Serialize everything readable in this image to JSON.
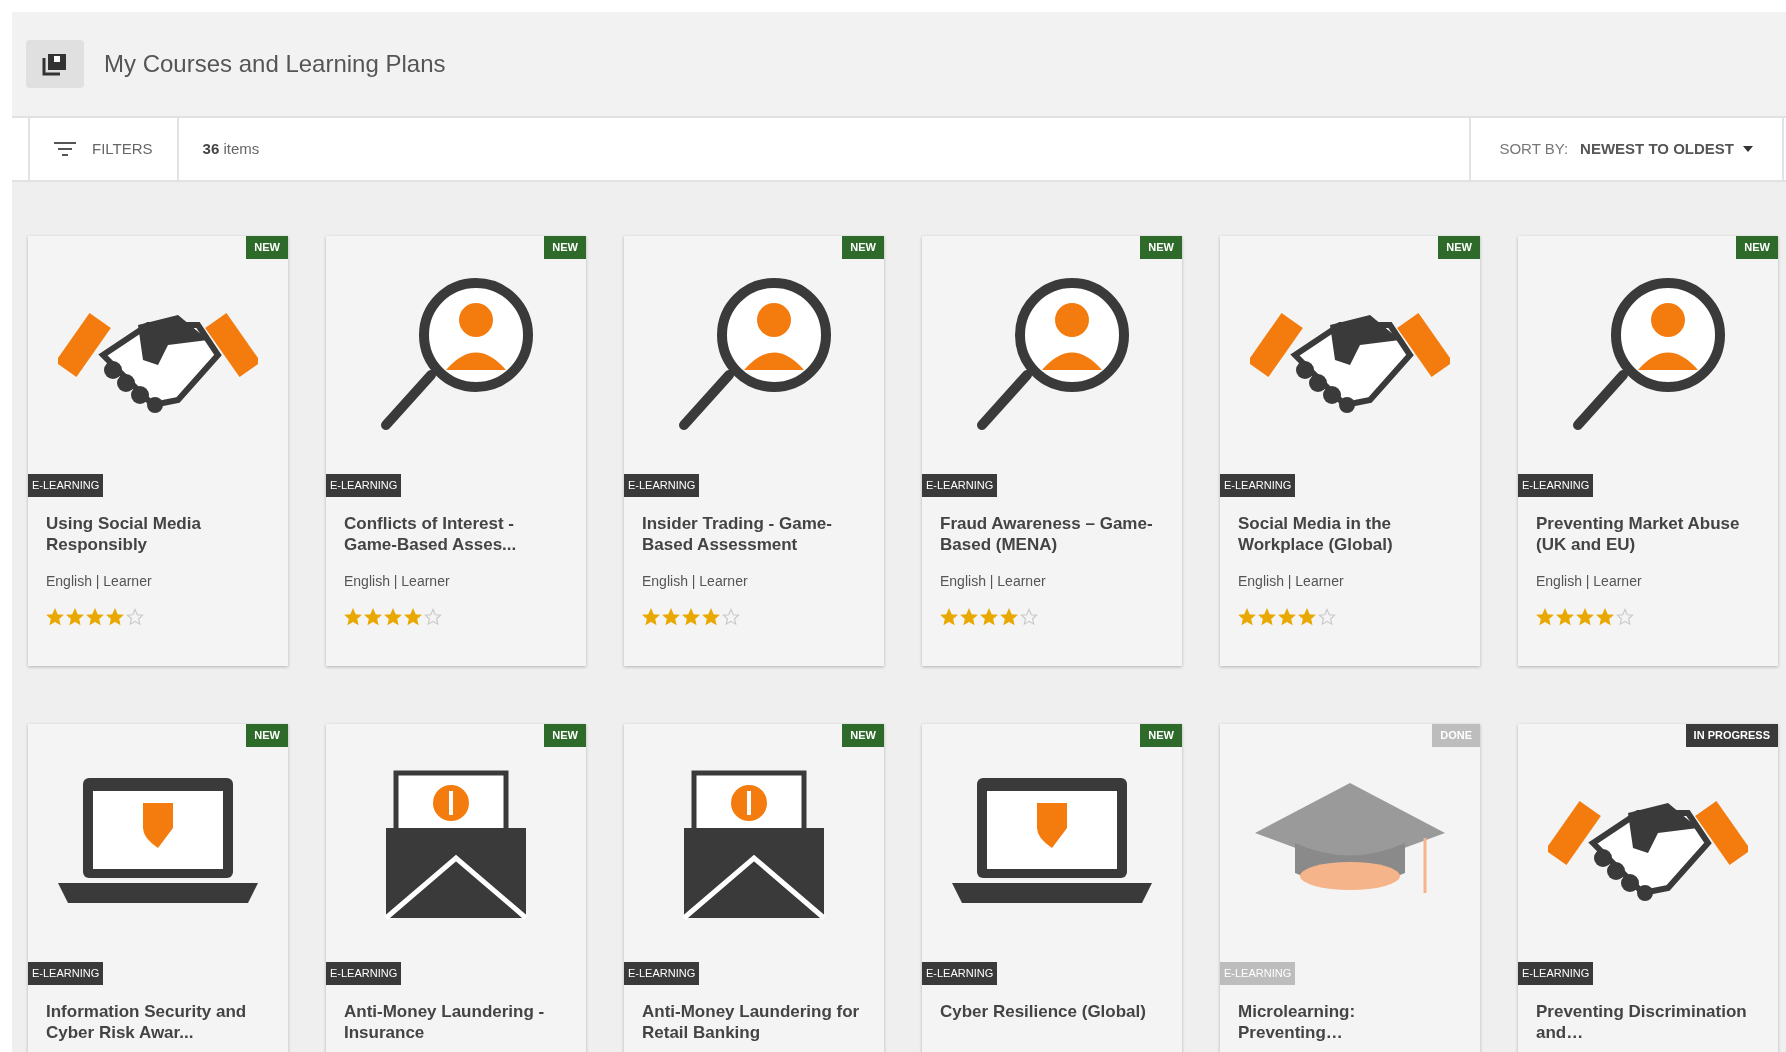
{
  "header": {
    "title": "My Courses and Learning Plans"
  },
  "toolbar": {
    "filters": "FILTERS",
    "count": "36",
    "count_label": "items",
    "sort_label": "SORT BY:",
    "sort_value": "NEWEST TO OLDEST"
  },
  "courses": [
    {
      "kind": "handshake",
      "status": {
        "label": "NEW",
        "color": "#2e6b2a"
      },
      "type": "E-LEARNING",
      "dimmed": false,
      "title": "Using Social Media Responsibly",
      "meta": "English | Learner",
      "stars": 4
    },
    {
      "kind": "magnifier",
      "status": {
        "label": "NEW",
        "color": "#2e6b2a"
      },
      "type": "E-LEARNING",
      "dimmed": false,
      "title": "Conflicts of Interest - Game-Based Asses...",
      "meta": "English | Learner",
      "stars": 4
    },
    {
      "kind": "magnifier",
      "status": {
        "label": "NEW",
        "color": "#2e6b2a"
      },
      "type": "E-LEARNING",
      "dimmed": false,
      "title": "Insider Trading - Game-Based Assessment",
      "meta": "English | Learner",
      "stars": 4
    },
    {
      "kind": "magnifier",
      "status": {
        "label": "NEW",
        "color": "#2e6b2a"
      },
      "type": "E-LEARNING",
      "dimmed": false,
      "title": "Fraud Awareness – Game-Based (MENA)",
      "meta": "English | Learner",
      "stars": 4
    },
    {
      "kind": "handshake",
      "status": {
        "label": "NEW",
        "color": "#2e6b2a"
      },
      "type": "E-LEARNING",
      "dimmed": false,
      "title": "Social Media in the Workplace (Global)",
      "meta": "English | Learner",
      "stars": 4
    },
    {
      "kind": "magnifier",
      "status": {
        "label": "NEW",
        "color": "#2e6b2a"
      },
      "type": "E-LEARNING",
      "dimmed": false,
      "title": "Preventing Market Abuse (UK and EU)",
      "meta": "English | Learner",
      "stars": 4
    },
    {
      "kind": "laptop",
      "status": {
        "label": "NEW",
        "color": "#2e6b2a"
      },
      "type": "E-LEARNING",
      "dimmed": false,
      "title": "Information Security and Cyber Risk Awar..."
    },
    {
      "kind": "money",
      "status": {
        "label": "NEW",
        "color": "#2e6b2a"
      },
      "type": "E-LEARNING",
      "dimmed": false,
      "title": "Anti-Money Laundering - Insurance"
    },
    {
      "kind": "money",
      "status": {
        "label": "NEW",
        "color": "#2e6b2a"
      },
      "type": "E-LEARNING",
      "dimmed": false,
      "title": "Anti-Money Laundering for Retail Banking"
    },
    {
      "kind": "laptop",
      "status": {
        "label": "NEW",
        "color": "#2e6b2a"
      },
      "type": "E-LEARNING",
      "dimmed": false,
      "title": "Cyber Resilience (Global)"
    },
    {
      "kind": "cap",
      "status": {
        "label": "DONE",
        "color": "#bdbdbd"
      },
      "type": "E-LEARNING",
      "dimmed": true,
      "title": "Microlearning: Preventing…"
    },
    {
      "kind": "handshake",
      "status": {
        "label": "IN PROGRESS",
        "color": "#3a3a3a"
      },
      "type": "E-LEARNING",
      "dimmed": false,
      "title": "Preventing Discrimination and…"
    }
  ]
}
